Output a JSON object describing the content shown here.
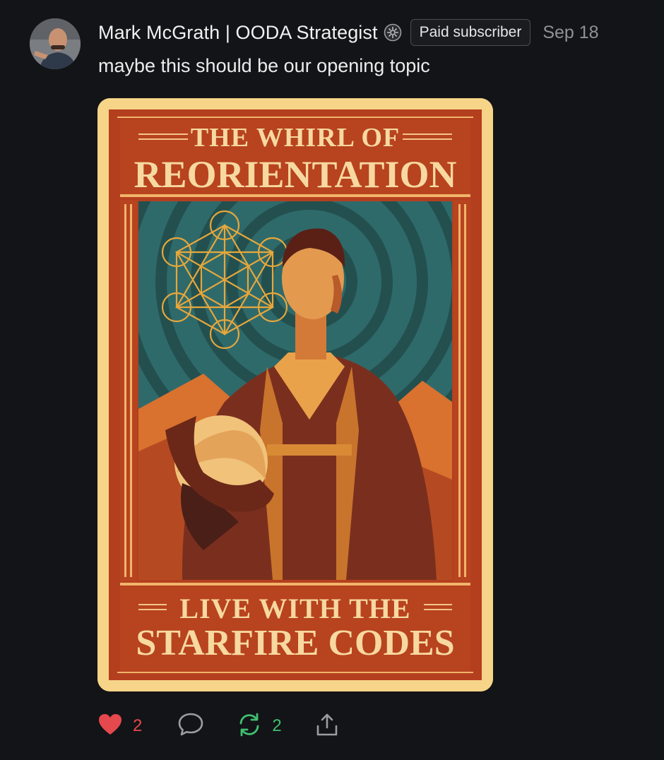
{
  "post": {
    "author": "Mark McGrath | OODA Strategist",
    "badge": "Paid subscriber",
    "date": "Sep 18",
    "text": "maybe this should be our opening topic"
  },
  "poster": {
    "title_top": "THE WHIRL OF",
    "title_main": "REORIENTATION",
    "footer_top": "LIVE WITH THE",
    "footer_main": "STARFIRE CODES"
  },
  "actions": {
    "likes": "2",
    "restacks": "2"
  },
  "icons": {
    "like": "heart-icon",
    "comment": "comment-icon",
    "restack": "restack-icon",
    "share": "share-icon",
    "verified": "verified-icon"
  },
  "colors": {
    "background": "#131417",
    "like": "#e5484d",
    "restack": "#3fbf70",
    "muted": "#8e9196"
  }
}
